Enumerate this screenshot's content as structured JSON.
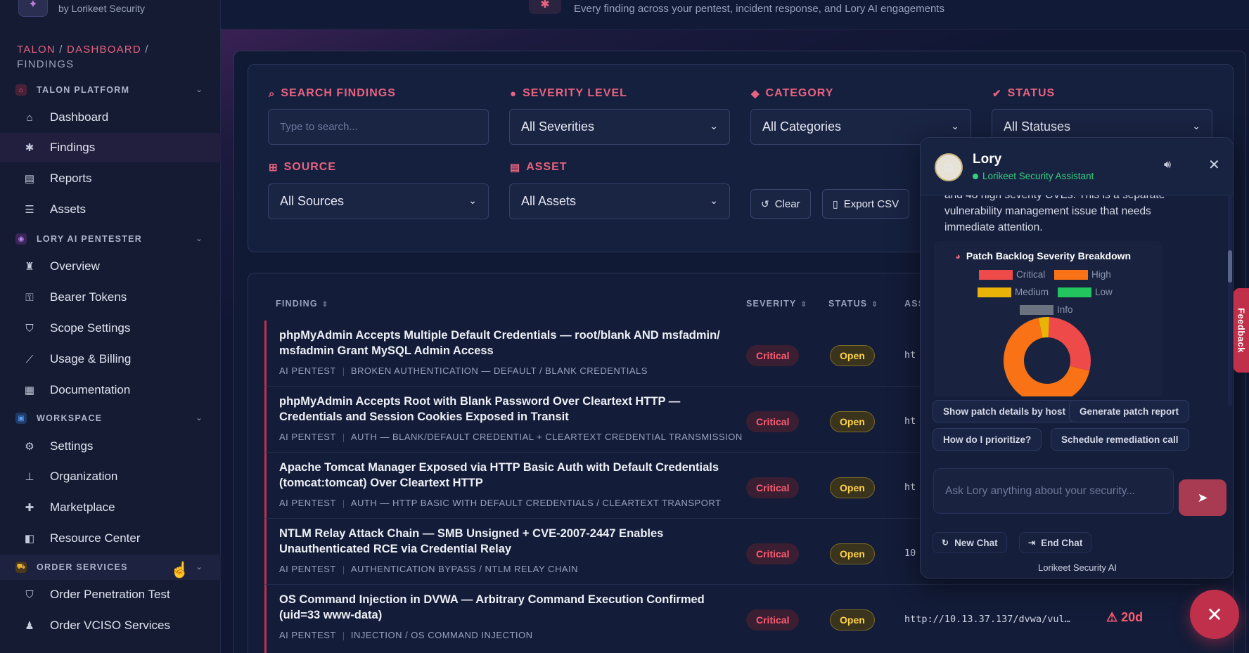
{
  "brand": {
    "subtitle": "by Lorikeet Security"
  },
  "topbar": {
    "subtitle": "Every finding across your pentest, incident response, and Lory AI engagements"
  },
  "breadcrumb": {
    "part1": "TALON",
    "part2": "DASHBOARD",
    "sep": "/",
    "current": "FINDINGS"
  },
  "sidebar": {
    "sections": [
      {
        "title": "TALON PLATFORM",
        "items": [
          "Dashboard",
          "Findings",
          "Reports",
          "Assets"
        ]
      },
      {
        "title": "LORY AI PENTESTER",
        "items": [
          "Overview",
          "Bearer Tokens",
          "Scope Settings",
          "Usage & Billing",
          "Documentation"
        ]
      },
      {
        "title": "WORKSPACE",
        "items": [
          "Settings",
          "Organization",
          "Marketplace",
          "Resource Center"
        ]
      },
      {
        "title": "ORDER SERVICES",
        "items": [
          "Order Penetration Test",
          "Order VCISO Services"
        ]
      }
    ],
    "active_item": "Findings"
  },
  "filters": {
    "search_label": "SEARCH FINDINGS",
    "search_placeholder": "Type to search...",
    "severity_label": "SEVERITY LEVEL",
    "severity_value": "All Severities",
    "category_label": "CATEGORY",
    "category_value": "All Categories",
    "status_label": "STATUS",
    "status_value": "All Statuses",
    "source_label": "SOURCE",
    "source_value": "All Sources",
    "asset_label": "ASSET",
    "asset_value": "All Assets",
    "clear_label": "Clear",
    "export_label": "Export CSV"
  },
  "table": {
    "headers": {
      "finding": "FINDING",
      "severity": "SEVERITY",
      "status": "STATUS",
      "asset": "ASS"
    },
    "rows": [
      {
        "title": "phpMyAdmin Accepts Multiple Default Credentials — root/blank AND msfadmin/ msfadmin Grant MySQL Admin Access",
        "source": "AI PENTEST",
        "category": "BROKEN AUTHENTICATION — DEFAULT / BLANK CREDENTIALS",
        "severity": "Critical",
        "status": "Open",
        "asset": "ht",
        "age": ""
      },
      {
        "title": "phpMyAdmin Accepts Root with Blank Password Over Cleartext HTTP — Credentials and Session Cookies Exposed in Transit",
        "source": "AI PENTEST",
        "category": "AUTH — BLANK/DEFAULT CREDENTIAL + CLEARTEXT CREDENTIAL TRANSMISSION",
        "severity": "Critical",
        "status": "Open",
        "asset": "ht",
        "age": ""
      },
      {
        "title": "Apache Tomcat Manager Exposed via HTTP Basic Auth with Default Credentials (tomcat:tomcat) Over Cleartext HTTP",
        "source": "AI PENTEST",
        "category": "AUTH — HTTP BASIC WITH DEFAULT CREDENTIALS / CLEARTEXT TRANSPORT",
        "severity": "Critical",
        "status": "Open",
        "asset": "ht",
        "age": ""
      },
      {
        "title": "NTLM Relay Attack Chain — SMB Unsigned + CVE-2007-2447 Enables Unauthenticated RCE via Credential Relay",
        "source": "AI PENTEST",
        "category": "AUTHENTICATION BYPASS / NTLM RELAY CHAIN",
        "severity": "Critical",
        "status": "Open",
        "asset": "10",
        "age": ""
      },
      {
        "title": "OS Command Injection in DVWA — Arbitrary Command Execution Confirmed (uid=33 www-data)",
        "source": "AI PENTEST",
        "category": "INJECTION / OS COMMAND INJECTION",
        "severity": "Critical",
        "status": "Open",
        "asset": "http://10.13.37.137/dvwa/vul…",
        "age": "20d"
      }
    ]
  },
  "chat": {
    "name": "Lory",
    "role": "Lorikeet Security Assistant",
    "message": "and 48 high severity CVEs. This is a separate vulnerability management issue that needs immediate attention.",
    "chart_title": "Patch Backlog Severity Breakdown",
    "chips": [
      "Show patch details by host",
      "Generate patch report",
      "How do I prioritize?",
      "Schedule remediation call"
    ],
    "input_placeholder": "Ask Lory anything about your security...",
    "new_chat": "New Chat",
    "end_chat": "End Chat",
    "footer": "Lorikeet Security AI"
  },
  "chart_data": {
    "type": "pie",
    "title": "Patch Backlog Severity Breakdown",
    "legend": [
      "Critical",
      "High",
      "Medium",
      "Low",
      "Info"
    ],
    "colors": {
      "Critical": "#ef4a4a",
      "High": "#f97316",
      "Medium": "#eab308",
      "Low": "#22c55e",
      "Info": "#6b7280"
    },
    "values": [
      {
        "name": "Critical",
        "value": 28
      },
      {
        "name": "High",
        "value": 68
      },
      {
        "name": "Medium",
        "value": 4
      },
      {
        "name": "Low",
        "value": 0
      },
      {
        "name": "Info",
        "value": 0
      }
    ]
  },
  "feedback": "Feedback",
  "colors": {
    "accent": "#e8637f",
    "critical": "#ff5c72",
    "open": "#ffd24a",
    "success": "#35d07f"
  }
}
